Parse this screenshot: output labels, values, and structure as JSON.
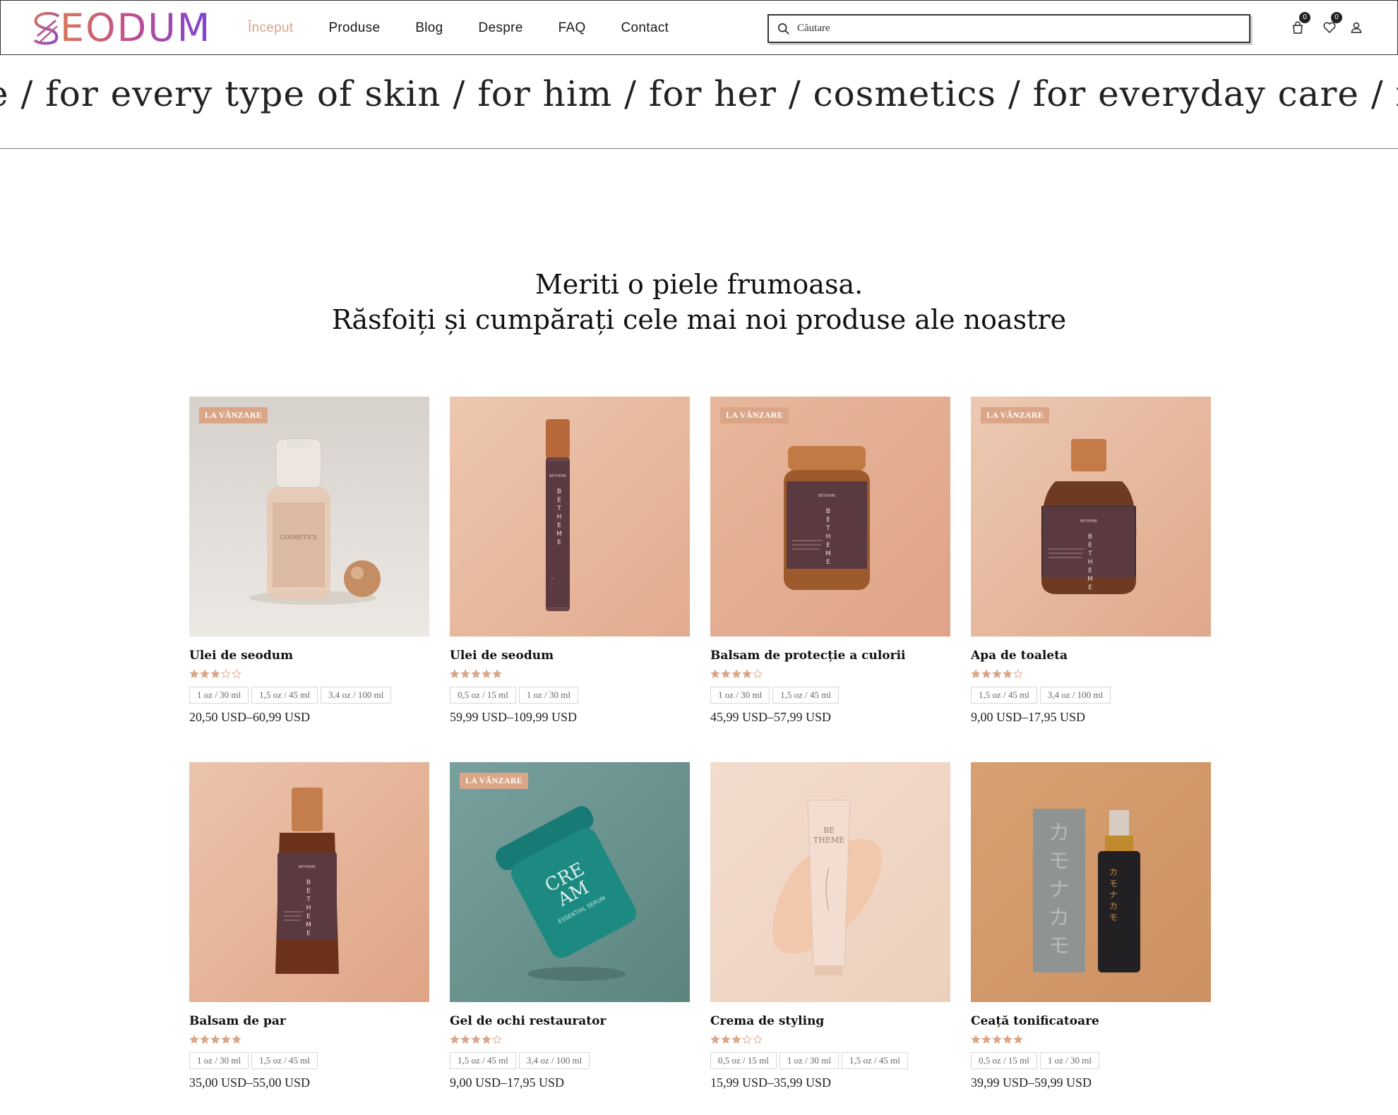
{
  "header": {
    "logo_text": "EODUM",
    "nav": [
      "Început",
      "Produse",
      "Blog",
      "Despre",
      "FAQ",
      "Contact"
    ],
    "active_nav": 0,
    "search_placeholder": "Căutare",
    "cart_count": "0",
    "wishlist_count": "0"
  },
  "marquee": {
    "text": "e / for every type of skin / for him / for her / cosmetics / for everyday care / for wrinkles"
  },
  "headline": {
    "line1": "Meriti o piele frumoasa.",
    "line2": "Răsfoiți și cumpărați cele mai noi produse ale noastre"
  },
  "colors": {
    "accent": "#dca28a",
    "sale_badge": "#dba688",
    "star": "#dba688"
  },
  "products": [
    {
      "name": "Ulei de seodum",
      "sale": "LA VÂNZARE",
      "rating": 3,
      "variants": [
        "1 oz / 30 ml",
        "1,5 oz / 45 ml",
        "3,4 oz / 100 ml"
      ],
      "price": "20,50 USD–60,99 USD",
      "image": "pump-bottle-cosmetics"
    },
    {
      "name": "Ulei de seodum",
      "sale": "",
      "rating": 5,
      "variants": [
        "0,5 oz / 15 ml",
        "1 oz / 30 ml"
      ],
      "price": "59,99 USD–109,99 USD",
      "image": "tall-bottle-betheme"
    },
    {
      "name": "Balsam de protecție a culorii",
      "sale": "LA VÂNZARE",
      "rating": 4,
      "variants": [
        "1 oz / 30 ml",
        "1,5 oz / 45 ml"
      ],
      "price": "45,99 USD–57,99 USD",
      "image": "jar-betheme"
    },
    {
      "name": "Apa de toaleta",
      "sale": "LA VÂNZARE",
      "rating": 4,
      "variants": [
        "1,5 oz / 45 ml",
        "3,4 oz / 100 ml"
      ],
      "price": "9,00 USD–17,95 USD",
      "image": "wide-bottle-betheme"
    },
    {
      "name": "Balsam de par",
      "sale": "",
      "rating": 5,
      "variants": [
        "1 oz / 30 ml",
        "1,5 oz / 45 ml"
      ],
      "price": "35,00 USD–55,00 USD",
      "image": "shaped-bottle-betheme"
    },
    {
      "name": "Gel de ochi restaurator",
      "sale": "LA VÂNZARE",
      "rating": 4,
      "variants": [
        "1,5 oz / 45 ml",
        "3,4 oz / 100 ml"
      ],
      "price": "9,00 USD–17,95 USD",
      "image": "teal-cream-jar"
    },
    {
      "name": "Crema de styling",
      "sale": "",
      "rating": 3,
      "variants": [
        "0,5 oz / 15 ml",
        "1 oz / 30 ml",
        "1,5 oz / 45 ml"
      ],
      "price": "15,99 USD–35,99 USD",
      "image": "tube-with-swatch"
    },
    {
      "name": "Ceață tonificatoare",
      "sale": "",
      "rating": 5,
      "variants": [
        "0,5 oz / 15 ml",
        "1 oz / 30 ml"
      ],
      "price": "39,99 USD–59,99 USD",
      "image": "spray-bottle-box"
    }
  ]
}
